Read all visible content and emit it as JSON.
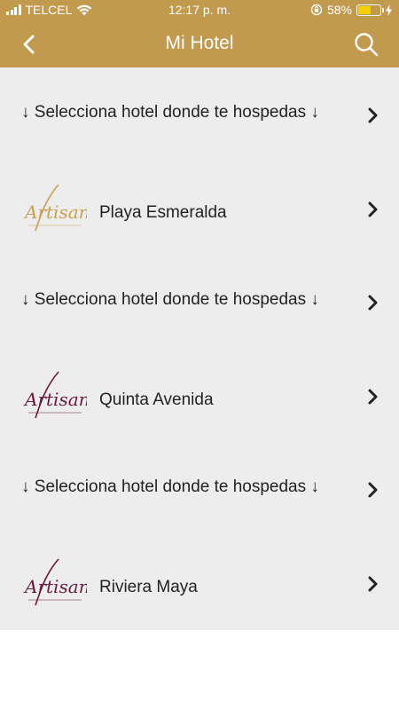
{
  "status_bar": {
    "carrier": "TELCEL",
    "time": "12:17 p. m.",
    "battery_percent": "58%",
    "battery_level": 0.58
  },
  "nav": {
    "title": "Mi Hotel",
    "back_icon": "chevron-left-icon",
    "search_icon": "search-icon"
  },
  "list": {
    "items": [
      {
        "type": "prompt",
        "label": "↓ Selecciona hotel donde te hospedas ↓"
      },
      {
        "type": "hotel",
        "label": "Playa Esmeralda",
        "logo_text": "Artisan",
        "logo_color": "#c8a04e"
      },
      {
        "type": "prompt",
        "label": "↓ Selecciona hotel donde te hospedas ↓"
      },
      {
        "type": "hotel",
        "label": "Quinta Avenida",
        "logo_text": "Artisan",
        "logo_color": "#6b1a3c"
      },
      {
        "type": "prompt",
        "label": "↓ Selecciona hotel donde te hospedas ↓"
      },
      {
        "type": "hotel",
        "label": "Riviera Maya",
        "logo_text": "Artisan",
        "logo_color": "#6b1a3c"
      }
    ]
  },
  "colors": {
    "header": "#c19a4e",
    "list_background": "#ededed"
  }
}
